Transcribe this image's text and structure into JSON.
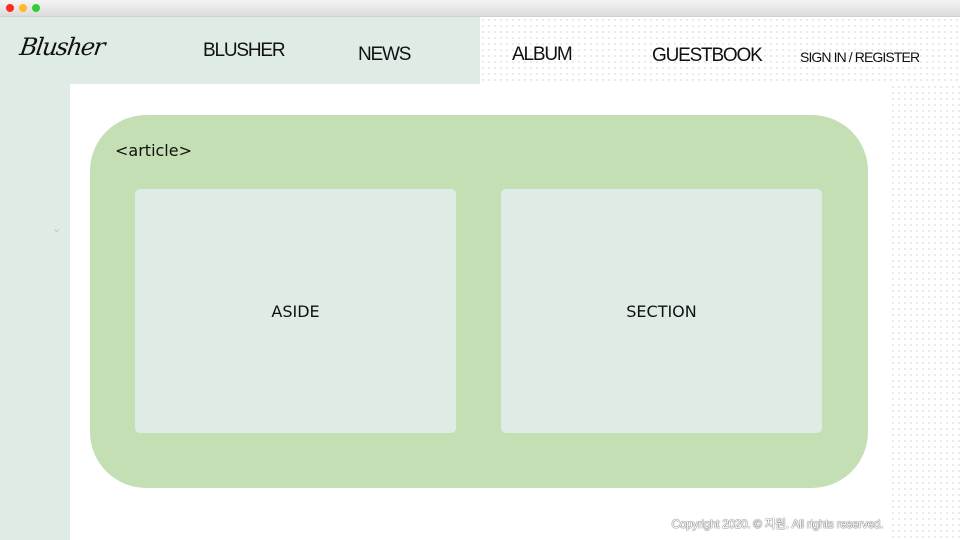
{
  "window": {
    "controls": [
      "close",
      "minimize",
      "maximize"
    ]
  },
  "colors": {
    "close": "#ff2a1f",
    "minimize": "#ffbb22",
    "maximize": "#33cc33",
    "header_bg": "#dfece6",
    "article_bg": "#c5dfb5",
    "box_bg": "#dfece6"
  },
  "header": {
    "logo": "Blusher",
    "nav": [
      "BLUSHER",
      "NEWS",
      "ALBUM",
      "GUESTBOOK"
    ],
    "auth": "SIGN IN / REGISTER"
  },
  "main": {
    "article_label": "<article>",
    "aside_label": "ASIDE",
    "section_label": "SECTION"
  },
  "footer": {
    "copyright": "Copyright 2020. © 지원. All rights reserved."
  }
}
